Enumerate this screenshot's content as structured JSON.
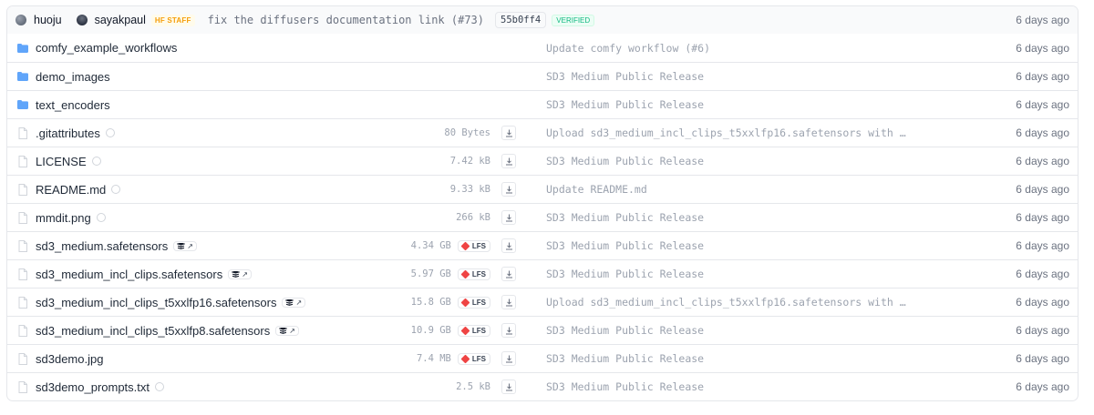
{
  "header": {
    "author1": "huoju",
    "author2": "sayakpaul",
    "staff_badge": "HF STAFF",
    "commit_message": "fix the diffusers documentation link (#73)",
    "commit_hash": "55b0ff4",
    "verified": "VERIFIED",
    "date": "6 days ago"
  },
  "files": [
    {
      "name": "comfy_example_workflows",
      "type": "folder",
      "size": "",
      "commit": "Update comfy workflow (#6)",
      "date": "6 days ago"
    },
    {
      "name": "demo_images",
      "type": "folder",
      "size": "",
      "commit": "SD3 Medium Public Release",
      "date": "6 days ago"
    },
    {
      "name": "text_encoders",
      "type": "folder",
      "size": "",
      "commit": "SD3 Medium Public Release",
      "date": "6 days ago"
    },
    {
      "name": ".gitattributes",
      "type": "file",
      "size": "80 Bytes",
      "commit": "Upload sd3_medium_incl_clips_t5xxlfp16.safetensors with …",
      "date": "6 days ago"
    },
    {
      "name": "LICENSE",
      "type": "file",
      "size": "7.42 kB",
      "commit": "SD3 Medium Public Release",
      "date": "6 days ago"
    },
    {
      "name": "README.md",
      "type": "file",
      "size": "9.33 kB",
      "commit": "Update README.md",
      "date": "6 days ago"
    },
    {
      "name": "mmdit.png",
      "type": "file",
      "size": "266 kB",
      "commit": "SD3 Medium Public Release",
      "date": "6 days ago"
    },
    {
      "name": "sd3_medium.safetensors",
      "type": "file",
      "size": "4.34 GB",
      "lfs": "LFS",
      "xet": "↗",
      "commit": "SD3 Medium Public Release",
      "date": "6 days ago"
    },
    {
      "name": "sd3_medium_incl_clips.safetensors",
      "type": "file",
      "size": "5.97 GB",
      "lfs": "LFS",
      "xet": "↗",
      "commit": "SD3 Medium Public Release",
      "date": "6 days ago"
    },
    {
      "name": "sd3_medium_incl_clips_t5xxlfp16.safetensors",
      "type": "file",
      "size": "15.8 GB",
      "lfs": "LFS",
      "xet": "↗",
      "commit": "Upload sd3_medium_incl_clips_t5xxlfp16.safetensors with …",
      "date": "6 days ago"
    },
    {
      "name": "sd3_medium_incl_clips_t5xxlfp8.safetensors",
      "type": "file",
      "size": "10.9 GB",
      "lfs": "LFS",
      "xet": "↗",
      "commit": "SD3 Medium Public Release",
      "date": "6 days ago"
    },
    {
      "name": "sd3demo.jpg",
      "type": "file",
      "size": "7.4 MB",
      "lfs": "LFS",
      "commit": "SD3 Medium Public Release",
      "date": "6 days ago"
    },
    {
      "name": "sd3demo_prompts.txt",
      "type": "file",
      "size": "2.5 kB",
      "commit": "SD3 Medium Public Release",
      "date": "6 days ago"
    }
  ],
  "colors": {
    "folder": "#60a5fa",
    "lfs": "#ef4444",
    "verified": "#10b981",
    "staff": "#f59e0b"
  },
  "icons": {
    "folder": "folder-icon",
    "file": "file-icon",
    "download": "download-icon",
    "lfs": "lfs-icon",
    "xet": "xet-icon",
    "safe": "safe-scan-icon"
  }
}
